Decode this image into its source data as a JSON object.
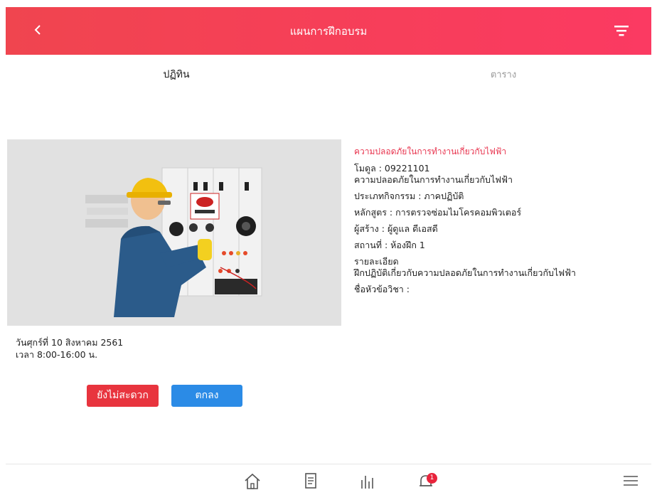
{
  "header": {
    "title": "แผนการฝึกอบรม",
    "back_icon": "chevron-left-icon",
    "filter_icon": "filter-icon"
  },
  "tabs": [
    {
      "label": "ปฏิทิน",
      "active": true
    },
    {
      "label": "ตาราง",
      "active": false
    }
  ],
  "course": {
    "title": "ความปลอดภัยในการทำงานเกี่ยวกับไฟฟ้า",
    "module": "โมดูล : 09221101",
    "module_name": "ความปลอดภัยในการทำงานเกี่ยวกับไฟฟ้า",
    "activity_type": "ประเภทกิจกรรม : ภาคปฏิบัติ",
    "curriculum": "หลักสูตร : การตรวจซ่อมไมโครคอมพิวเตอร์",
    "creator": "ผู้สร้าง : ผู้ดูแล ดีเอสดี",
    "location": "สถานที่ : ห้องฝึก 1",
    "details_label": "รายละเอียด",
    "details": "ฝึกปฏิบัติเกี่ยวกับความปลอดภัยในการทำงานเกี่ยวกับไฟฟ้า",
    "topic": "ชื่อหัวข้อวิชา :"
  },
  "schedule": {
    "date": "วันศุกร์ที่ 10 สิงหาคม 2561",
    "time": "เวลา 8:00-16:00 น."
  },
  "buttons": {
    "decline": "ยังไม่สะดวก",
    "accept": "ตกลง"
  },
  "bottom_nav": {
    "home_icon": "home-icon",
    "document_icon": "document-icon",
    "chart_icon": "bar-chart-icon",
    "bell_icon": "bell-icon",
    "bell_badge": "1",
    "menu_icon": "menu-icon"
  },
  "colors": {
    "header": "#f63f58",
    "accent_red": "#e8344e",
    "decline": "#e8343e",
    "accept": "#2b8be6"
  }
}
